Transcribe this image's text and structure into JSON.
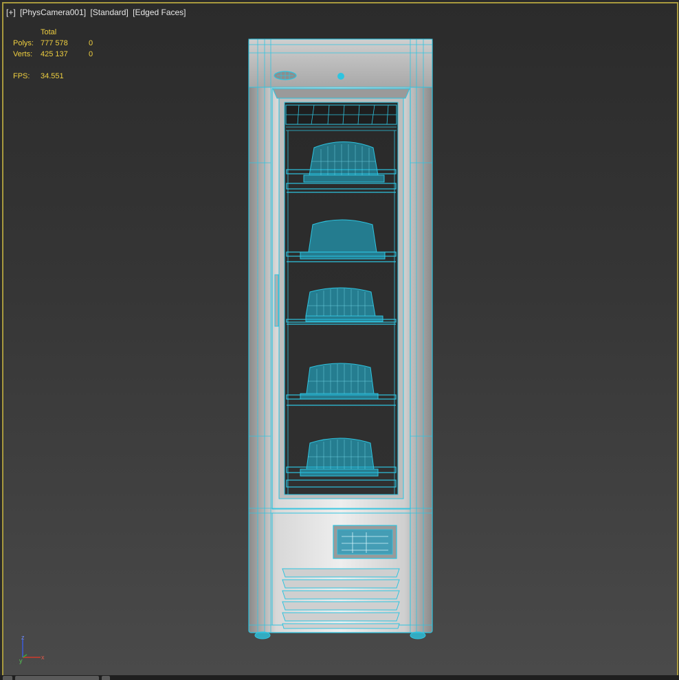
{
  "viewport": {
    "label": {
      "plus": "[+]",
      "camera": "[PhysCamera001]",
      "shading": "[Standard]",
      "mode": "[Edged Faces]"
    },
    "stats": {
      "header": "Total",
      "polys_label": "Polys:",
      "polys_total": "777 578",
      "polys_selected": "0",
      "verts_label": "Verts:",
      "verts_total": "425 137",
      "verts_selected": "0",
      "fps_label": "FPS:",
      "fps_value": "34.551"
    },
    "axis": {
      "z": "z",
      "y": "y",
      "x": "x"
    }
  },
  "colors": {
    "border": "#a99a3e",
    "wire": "#2ec4e0",
    "stats_text": "#f0d040",
    "label_text": "#e8e8e8"
  },
  "scene": {
    "object": "glass-door-refrigerator",
    "shelves": 5,
    "baskets": 5,
    "vent_slats": 6
  }
}
